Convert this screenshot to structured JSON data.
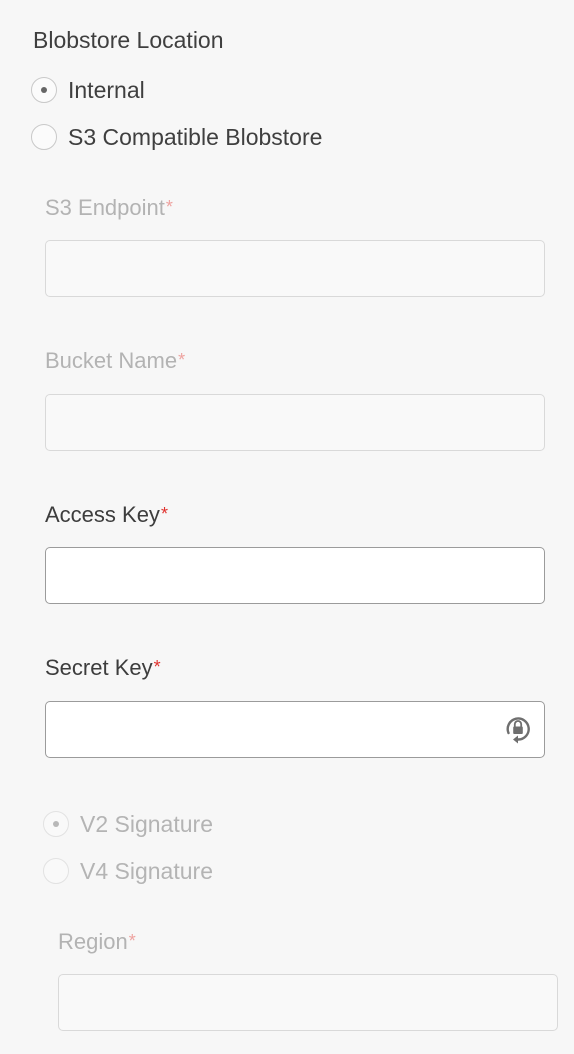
{
  "blobstore_location": {
    "title": "Blobstore Location",
    "options": [
      {
        "label": "Internal",
        "selected": true
      },
      {
        "label": "S3 Compatible Blobstore",
        "selected": false
      }
    ]
  },
  "s3_endpoint": {
    "label": "S3 Endpoint",
    "required_marker": "*",
    "value": "",
    "disabled": true
  },
  "bucket_name": {
    "label": "Bucket Name",
    "required_marker": "*",
    "value": "",
    "disabled": true
  },
  "access_key": {
    "label": "Access Key",
    "required_marker": "*",
    "value": "",
    "disabled": false
  },
  "secret_key": {
    "label": "Secret Key",
    "required_marker": "*",
    "value": "",
    "disabled": false,
    "icon": "lock-refresh-icon"
  },
  "signature": {
    "disabled": true,
    "options": [
      {
        "label": "V2 Signature",
        "selected": true
      },
      {
        "label": "V4 Signature",
        "selected": false
      }
    ]
  },
  "region": {
    "label": "Region",
    "required_marker": "*",
    "value": "",
    "disabled": true
  },
  "colors": {
    "background": "#f7f7f7",
    "required": "#e0322e",
    "text": "#3d3d3d",
    "disabled_text": "#b3b3b3",
    "input_border": "#9b9b9b"
  }
}
